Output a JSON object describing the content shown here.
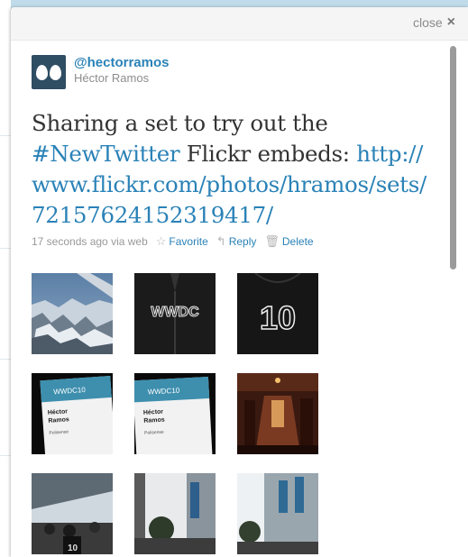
{
  "panel": {
    "close_label": "close",
    "close_icon": "×"
  },
  "tweet": {
    "screen_name": "@hectorramos",
    "full_name": "Héctor Ramos",
    "text_before": "Sharing a set to try out the",
    "hashtag": "#NewTwitter",
    "text_after": " Flickr embeds:",
    "link": "http://www.flickr.com/photos/hramos/sets/72157624152319417/",
    "timestamp": "17 seconds ago via web",
    "actions": {
      "favorite": "Favorite",
      "reply": "Reply",
      "delete": "Delete"
    }
  },
  "thumbs_row1_sign": "WWDC",
  "thumbs_row1_number": "10",
  "badge_event": "WWDC10",
  "badge_name_line1": "Héctor",
  "badge_name_line2": "Ramos",
  "badge_company": "Polisense",
  "colors": {
    "link": "#2a82b7",
    "background": "#c0dbe9"
  }
}
